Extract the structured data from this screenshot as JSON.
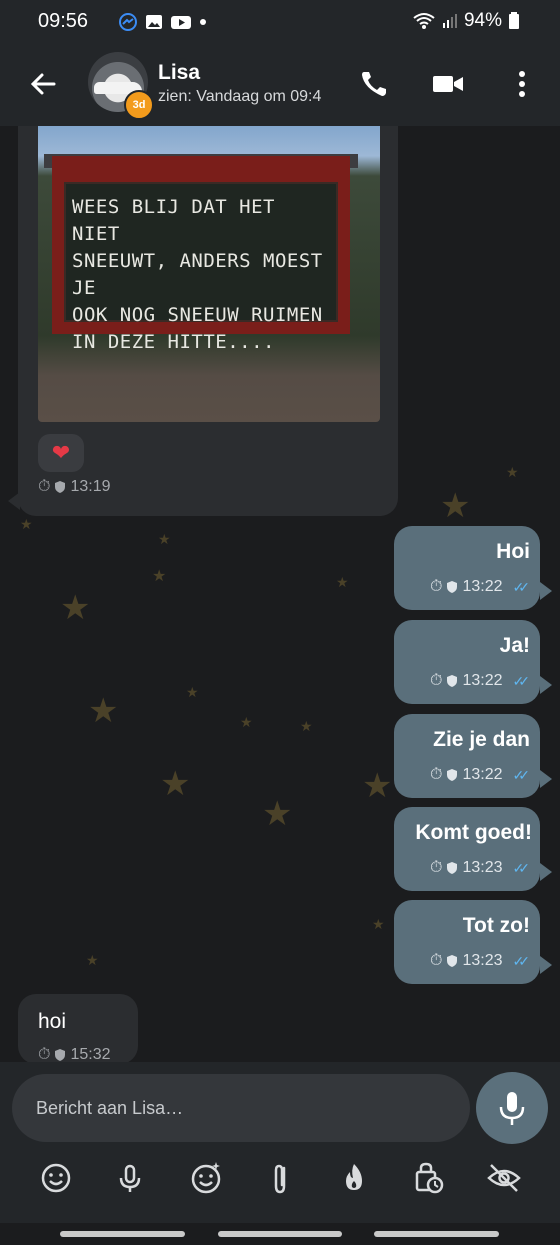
{
  "status_bar": {
    "time": "09:56",
    "battery": "94%",
    "icons": [
      "messenger-icon",
      "gallery-icon",
      "youtube-icon",
      "dot-icon",
      "wifi-icon",
      "signal-icon",
      "battery-icon"
    ]
  },
  "header": {
    "name": "Lisa",
    "subtitle": "zien: Vandaag om 09:4",
    "badge": "3d"
  },
  "messages": {
    "incoming_image": {
      "board_lines": [
        "WEES BLIJ DAT HET NIET",
        "SNEEUWT, ANDERS MOEST JE",
        "OOK NOG SNEEUW RUIMEN",
        "IN DEZE HITTE...."
      ],
      "reaction": "❤",
      "time": "13:19"
    },
    "outgoing": [
      {
        "text": "Hoi",
        "time": "13:22"
      },
      {
        "text": "Ja!",
        "time": "13:22"
      },
      {
        "text": "Zie je dan",
        "time": "13:22"
      },
      {
        "text": "Komt goed!",
        "time": "13:23"
      },
      {
        "text": "Tot zo!",
        "time": "13:23"
      }
    ],
    "incoming_last": {
      "text": "hoi",
      "time": "15:32"
    }
  },
  "composer": {
    "placeholder": "Bericht aan Lisa…"
  },
  "colors": {
    "outgoing_bubble": "#5a6f7b",
    "incoming_bubble": "#2b2d30",
    "badge": "#f39b1c",
    "read_ticks": "#5fb6f0"
  }
}
